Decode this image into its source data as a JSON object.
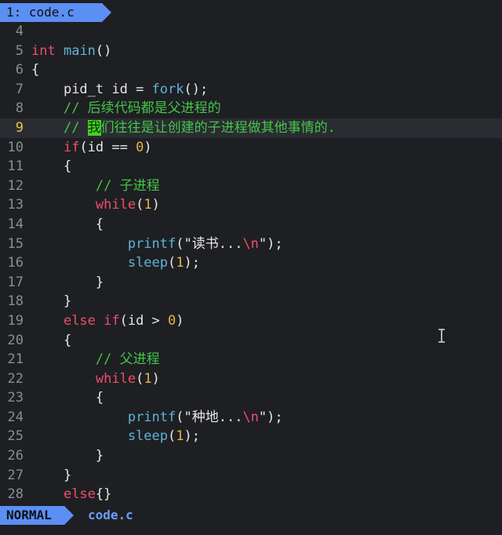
{
  "tab": {
    "label": "1: code.c"
  },
  "lines": [
    {
      "num": "4",
      "indent": "",
      "tokens": []
    },
    {
      "num": "5",
      "indent": "",
      "tokens": [
        {
          "c": "ty",
          "t": "int"
        },
        {
          "c": "",
          "t": " "
        },
        {
          "c": "fn",
          "t": "main"
        },
        {
          "c": "",
          "t": "()"
        }
      ]
    },
    {
      "num": "6",
      "indent": "",
      "tokens": [
        {
          "c": "",
          "t": "{"
        }
      ]
    },
    {
      "num": "7",
      "indent": "    ",
      "tokens": [
        {
          "c": "",
          "t": "pid_t id = "
        },
        {
          "c": "fn",
          "t": "fork"
        },
        {
          "c": "",
          "t": "();"
        }
      ]
    },
    {
      "num": "8",
      "indent": "    ",
      "tokens": [
        {
          "c": "cm",
          "t": "// 后续代码都是父进程的"
        }
      ]
    },
    {
      "num": "9",
      "indent": "    ",
      "current": true,
      "tokens": [
        {
          "c": "cm",
          "t": "// "
        },
        {
          "c": "cursor",
          "t": "我"
        },
        {
          "c": "cm",
          "t": "们往往是让创建的子进程做其他事情的."
        }
      ]
    },
    {
      "num": "10",
      "indent": "    ",
      "tokens": [
        {
          "c": "kw",
          "t": "if"
        },
        {
          "c": "",
          "t": "(id == "
        },
        {
          "c": "num",
          "t": "0"
        },
        {
          "c": "",
          "t": ")"
        }
      ]
    },
    {
      "num": "11",
      "indent": "    ",
      "tokens": [
        {
          "c": "",
          "t": "{"
        }
      ]
    },
    {
      "num": "12",
      "indent": "        ",
      "tokens": [
        {
          "c": "cm",
          "t": "// 子进程"
        }
      ]
    },
    {
      "num": "13",
      "indent": "        ",
      "tokens": [
        {
          "c": "kw",
          "t": "while"
        },
        {
          "c": "",
          "t": "("
        },
        {
          "c": "num",
          "t": "1"
        },
        {
          "c": "",
          "t": ")"
        }
      ]
    },
    {
      "num": "14",
      "indent": "        ",
      "tokens": [
        {
          "c": "",
          "t": "{"
        }
      ]
    },
    {
      "num": "15",
      "indent": "            ",
      "tokens": [
        {
          "c": "fn",
          "t": "printf"
        },
        {
          "c": "",
          "t": "(\"读书..."
        },
        {
          "c": "esc",
          "t": "\\n"
        },
        {
          "c": "",
          "t": "\");"
        }
      ]
    },
    {
      "num": "16",
      "indent": "            ",
      "tokens": [
        {
          "c": "fn",
          "t": "sleep"
        },
        {
          "c": "",
          "t": "("
        },
        {
          "c": "num",
          "t": "1"
        },
        {
          "c": "",
          "t": ");"
        }
      ]
    },
    {
      "num": "17",
      "indent": "        ",
      "tokens": [
        {
          "c": "",
          "t": "}"
        }
      ]
    },
    {
      "num": "18",
      "indent": "    ",
      "tokens": [
        {
          "c": "",
          "t": "}"
        }
      ]
    },
    {
      "num": "19",
      "indent": "    ",
      "tokens": [
        {
          "c": "kw",
          "t": "else if"
        },
        {
          "c": "",
          "t": "(id > "
        },
        {
          "c": "num",
          "t": "0"
        },
        {
          "c": "",
          "t": ")"
        }
      ]
    },
    {
      "num": "20",
      "indent": "    ",
      "tokens": [
        {
          "c": "",
          "t": "{"
        }
      ]
    },
    {
      "num": "21",
      "indent": "        ",
      "tokens": [
        {
          "c": "cm",
          "t": "// 父进程"
        }
      ]
    },
    {
      "num": "22",
      "indent": "        ",
      "tokens": [
        {
          "c": "kw",
          "t": "while"
        },
        {
          "c": "",
          "t": "("
        },
        {
          "c": "num",
          "t": "1"
        },
        {
          "c": "",
          "t": ")"
        }
      ]
    },
    {
      "num": "23",
      "indent": "        ",
      "tokens": [
        {
          "c": "",
          "t": "{"
        }
      ]
    },
    {
      "num": "24",
      "indent": "            ",
      "tokens": [
        {
          "c": "fn",
          "t": "printf"
        },
        {
          "c": "",
          "t": "(\"种地..."
        },
        {
          "c": "esc",
          "t": "\\n"
        },
        {
          "c": "",
          "t": "\");"
        }
      ]
    },
    {
      "num": "25",
      "indent": "            ",
      "tokens": [
        {
          "c": "fn",
          "t": "sleep"
        },
        {
          "c": "",
          "t": "("
        },
        {
          "c": "num",
          "t": "1"
        },
        {
          "c": "",
          "t": ");"
        }
      ]
    },
    {
      "num": "26",
      "indent": "        ",
      "tokens": [
        {
          "c": "",
          "t": "}"
        }
      ]
    },
    {
      "num": "27",
      "indent": "    ",
      "tokens": [
        {
          "c": "",
          "t": "}"
        }
      ]
    },
    {
      "num": "28",
      "indent": "    ",
      "tokens": [
        {
          "c": "kw",
          "t": "else"
        },
        {
          "c": "",
          "t": "{}"
        }
      ]
    }
  ],
  "status": {
    "mode": "NORMAL",
    "file": "code.c"
  },
  "colors": {
    "accent": "#5b8ff4",
    "keyword": "#f04d6e",
    "function": "#5db4d9",
    "number": "#e6b34a",
    "comment": "#43c64a",
    "cursor": "#44d41f"
  }
}
